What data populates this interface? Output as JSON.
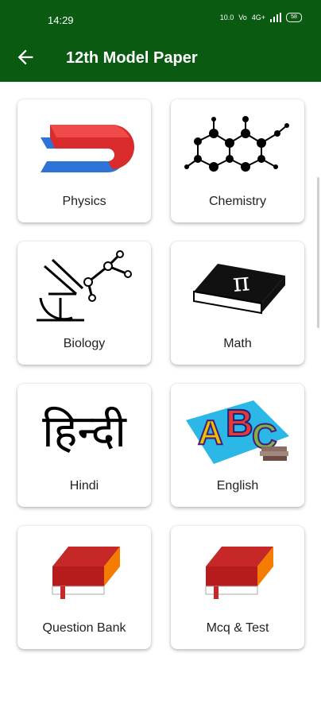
{
  "status": {
    "time": "14:29",
    "net1": "10.0",
    "net2": "Vo",
    "lte": "4G+",
    "battery": "58"
  },
  "header": {
    "title": "12th Model Paper"
  },
  "subjects": [
    {
      "label": "Physics"
    },
    {
      "label": "Chemistry"
    },
    {
      "label": "Biology"
    },
    {
      "label": "Math"
    },
    {
      "label": "Hindi",
      "image_text": "हिन्दी"
    },
    {
      "label": "English"
    },
    {
      "label": "Question Bank"
    },
    {
      "label": "Mcq & Test"
    }
  ],
  "colors": {
    "appbar": "#0b5a12",
    "book_red": "#c62828",
    "book_orange": "#f57c00"
  }
}
